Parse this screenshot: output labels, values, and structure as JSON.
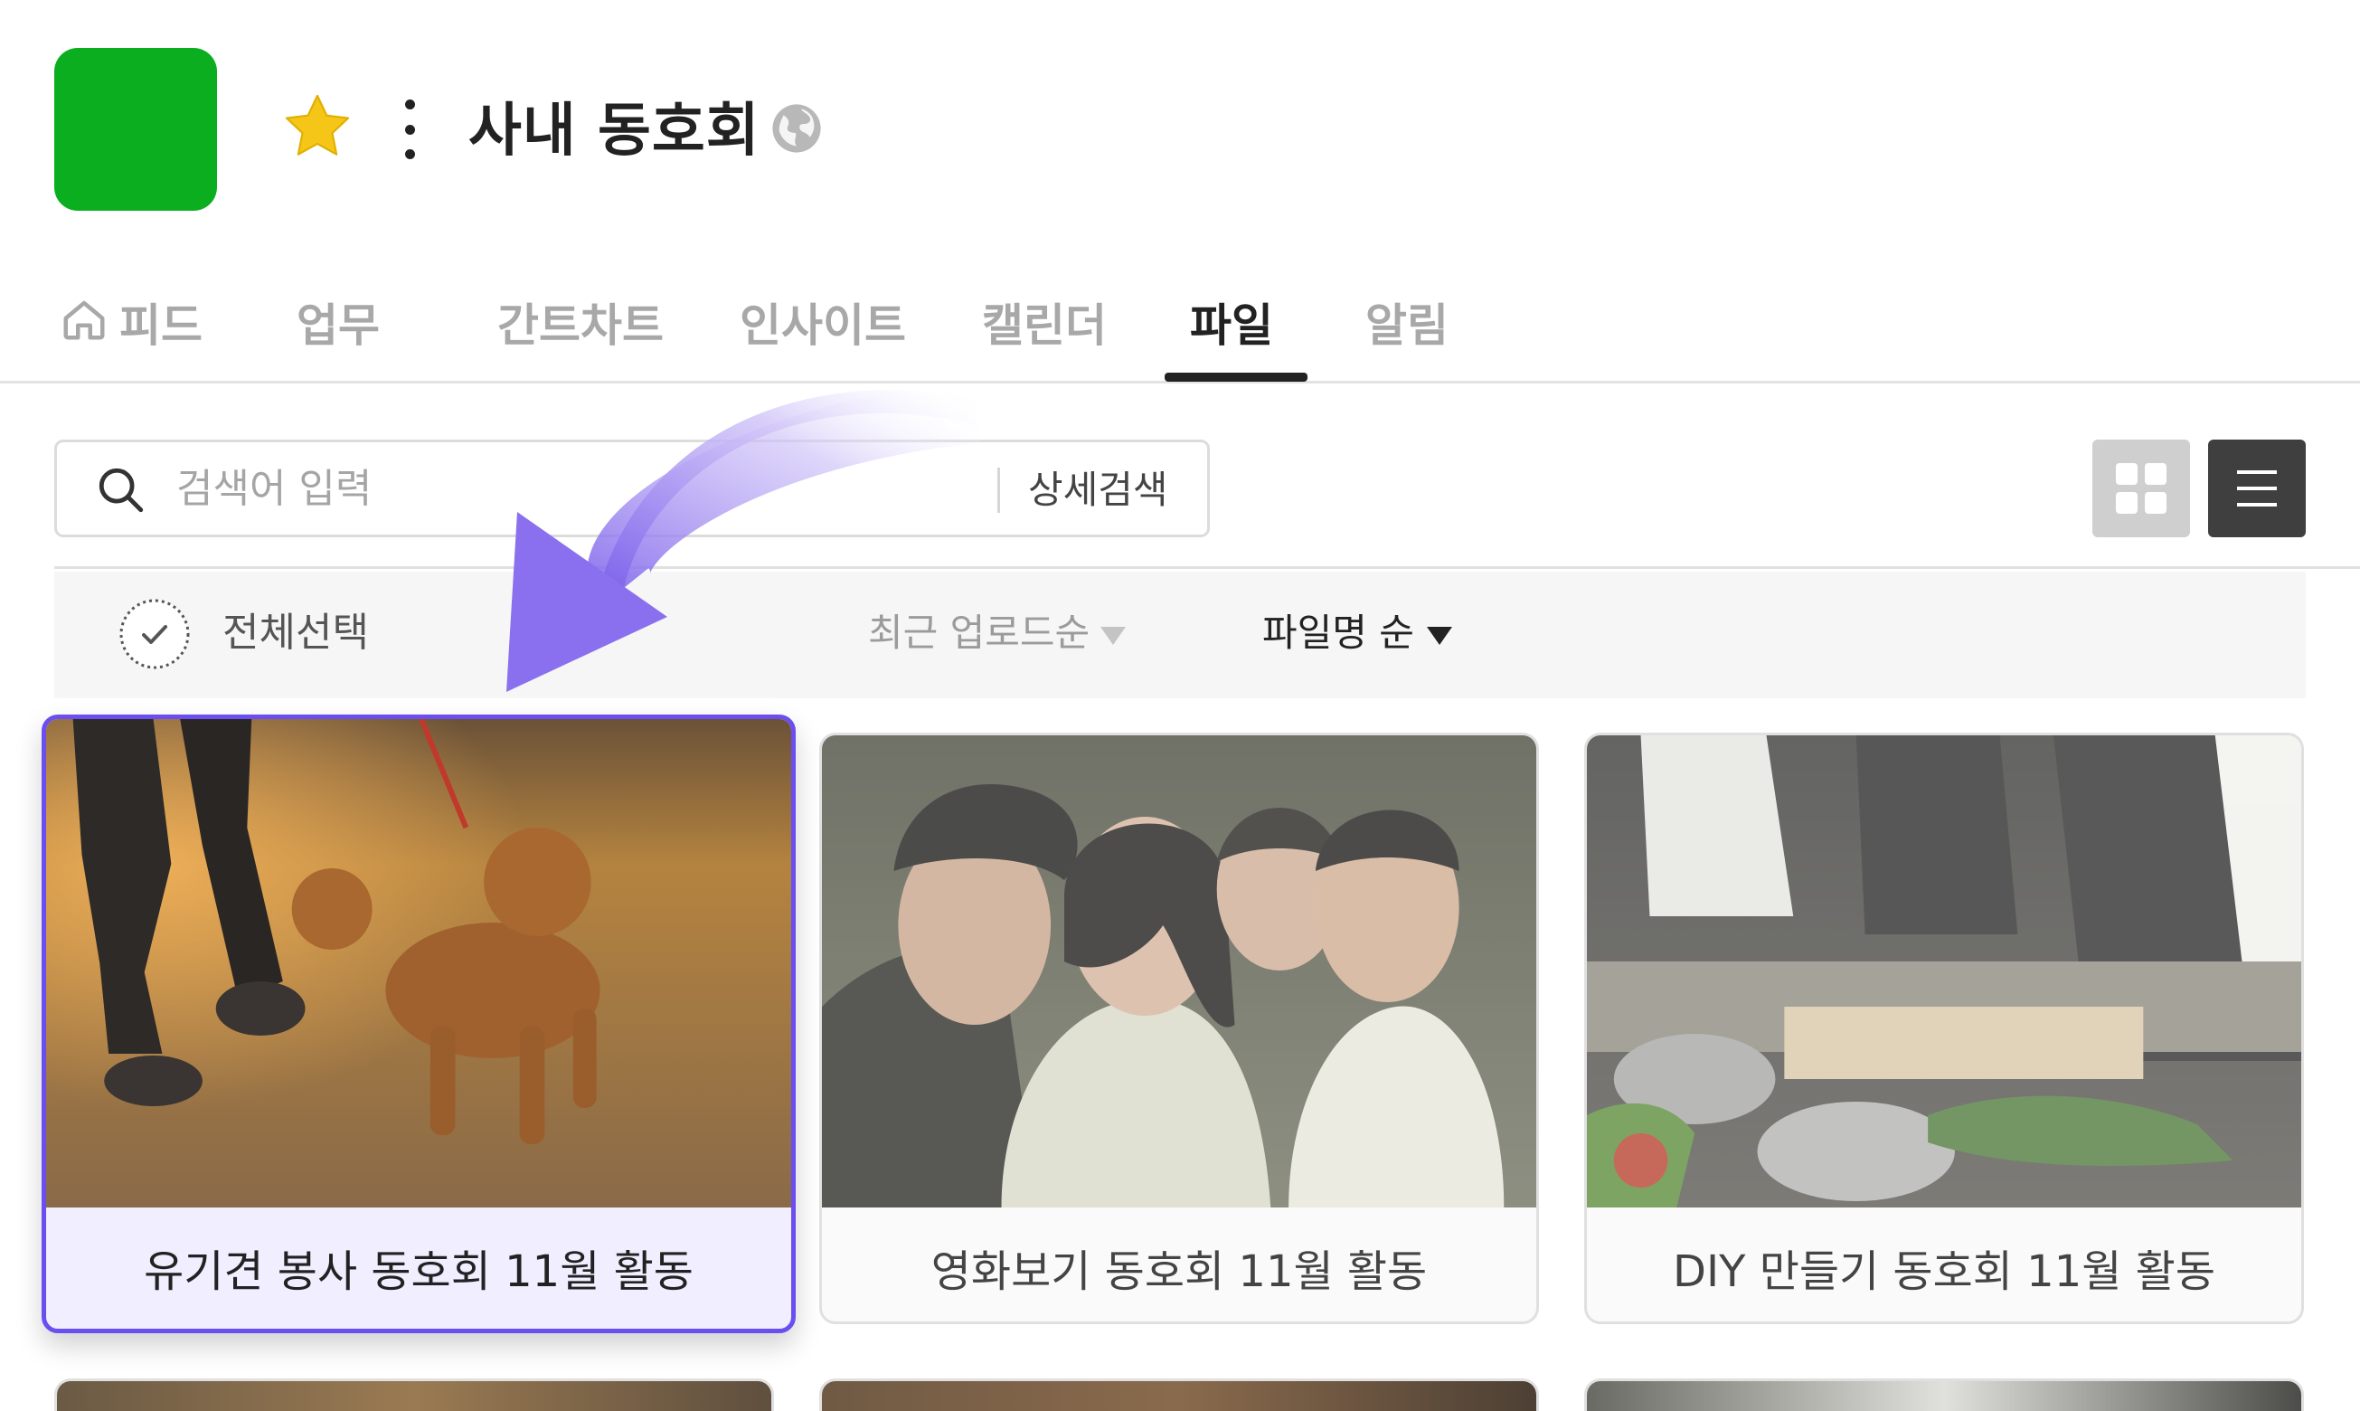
{
  "header": {
    "title": "사내 동호회",
    "logo_color": "#0bae1f",
    "star_color": "#f5c518"
  },
  "tabs": [
    {
      "label": "피드",
      "icon": "home-icon",
      "active": false
    },
    {
      "label": "업무",
      "active": false
    },
    {
      "label": "간트차트",
      "active": false
    },
    {
      "label": "인사이트",
      "active": false
    },
    {
      "label": "캘린더",
      "active": false
    },
    {
      "label": "파일",
      "active": true
    },
    {
      "label": "알림",
      "active": false
    }
  ],
  "search": {
    "placeholder": "검색어 입력",
    "advanced_label": "상세검색"
  },
  "filter": {
    "select_all_label": "전체선택",
    "sort_recent_label": "최근 업로드순",
    "sort_name_label": "파일명 순"
  },
  "files": [
    {
      "name": "유기견 봉사 동호회 11월 활동",
      "selected": true
    },
    {
      "name": "영화보기 동호회 11월 활동",
      "selected": false
    },
    {
      "name": "DIY 만들기 동호회 11월 활동",
      "selected": false
    }
  ],
  "colors": {
    "accent": "#6a4ef0",
    "arrow": "#8f78f0"
  }
}
